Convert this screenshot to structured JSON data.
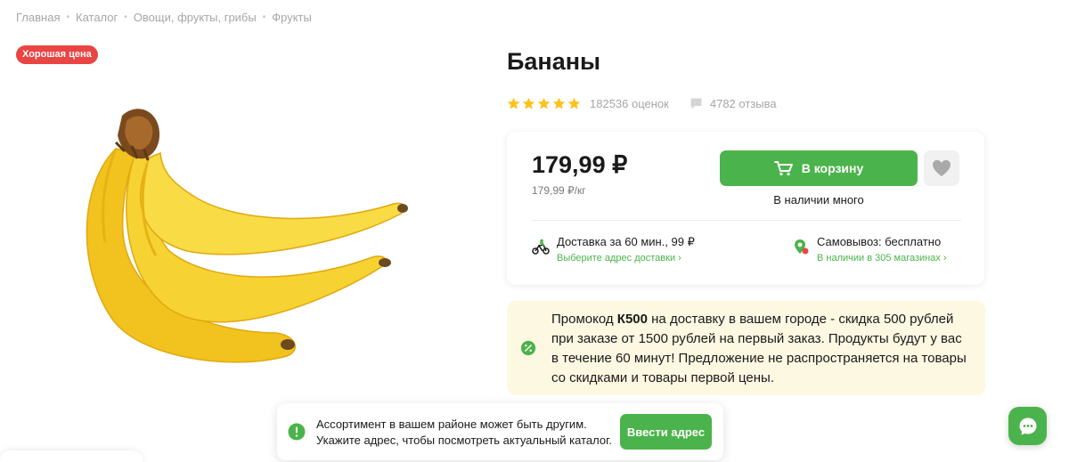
{
  "breadcrumb": [
    {
      "label": "Главная"
    },
    {
      "label": "Каталог"
    },
    {
      "label": "Овощи, фрукты, грибы"
    },
    {
      "label": "Фрукты"
    }
  ],
  "badge": "Хорошая цена",
  "product": {
    "title": "Бананы",
    "rating_stars": 5,
    "rating_count": "182536 оценок",
    "reviews_count": "4782 отзыва"
  },
  "price": {
    "main": "179,99 ₽",
    "unit": "179,99 ₽/кг",
    "cart_label": "В корзину",
    "stock": "В наличии много"
  },
  "delivery": {
    "title": "Доставка за 60 мин., 99 ₽",
    "link": "Выберите адрес доставки ›"
  },
  "pickup": {
    "title": "Самовывоз: бесплатно",
    "link": "В наличии в 305 магазинах ›"
  },
  "promo": {
    "prefix": "Промокод ",
    "code": "К500",
    "text": " на доставку в вашем городе - скидка 500 рублей при заказе от 1500 рублей на первый заказ. Продукты будут у вас в течение 60 минут! Предложение не распространяется на товары со скидками и товары первой цены."
  },
  "notice": {
    "line1": "Ассортимент в вашем районе может быть другим.",
    "line2": "Укажите адрес, чтобы посмотреть актуальный каталог.",
    "button": "Ввести адрес"
  },
  "colors": {
    "accent_green": "#4bb34b",
    "badge_red": "#e94544",
    "star_yellow": "#ffc21a",
    "promo_bg": "#fdf8e2"
  },
  "icons": {
    "stars": "star-icon",
    "reviews": "comment-icon",
    "cart": "cart-icon",
    "favorite": "heart-icon",
    "delivery": "courier-bike-icon",
    "pickup": "store-pin-icon",
    "promo": "discount-icon",
    "notice": "alert-icon",
    "chat": "chat-icon"
  }
}
